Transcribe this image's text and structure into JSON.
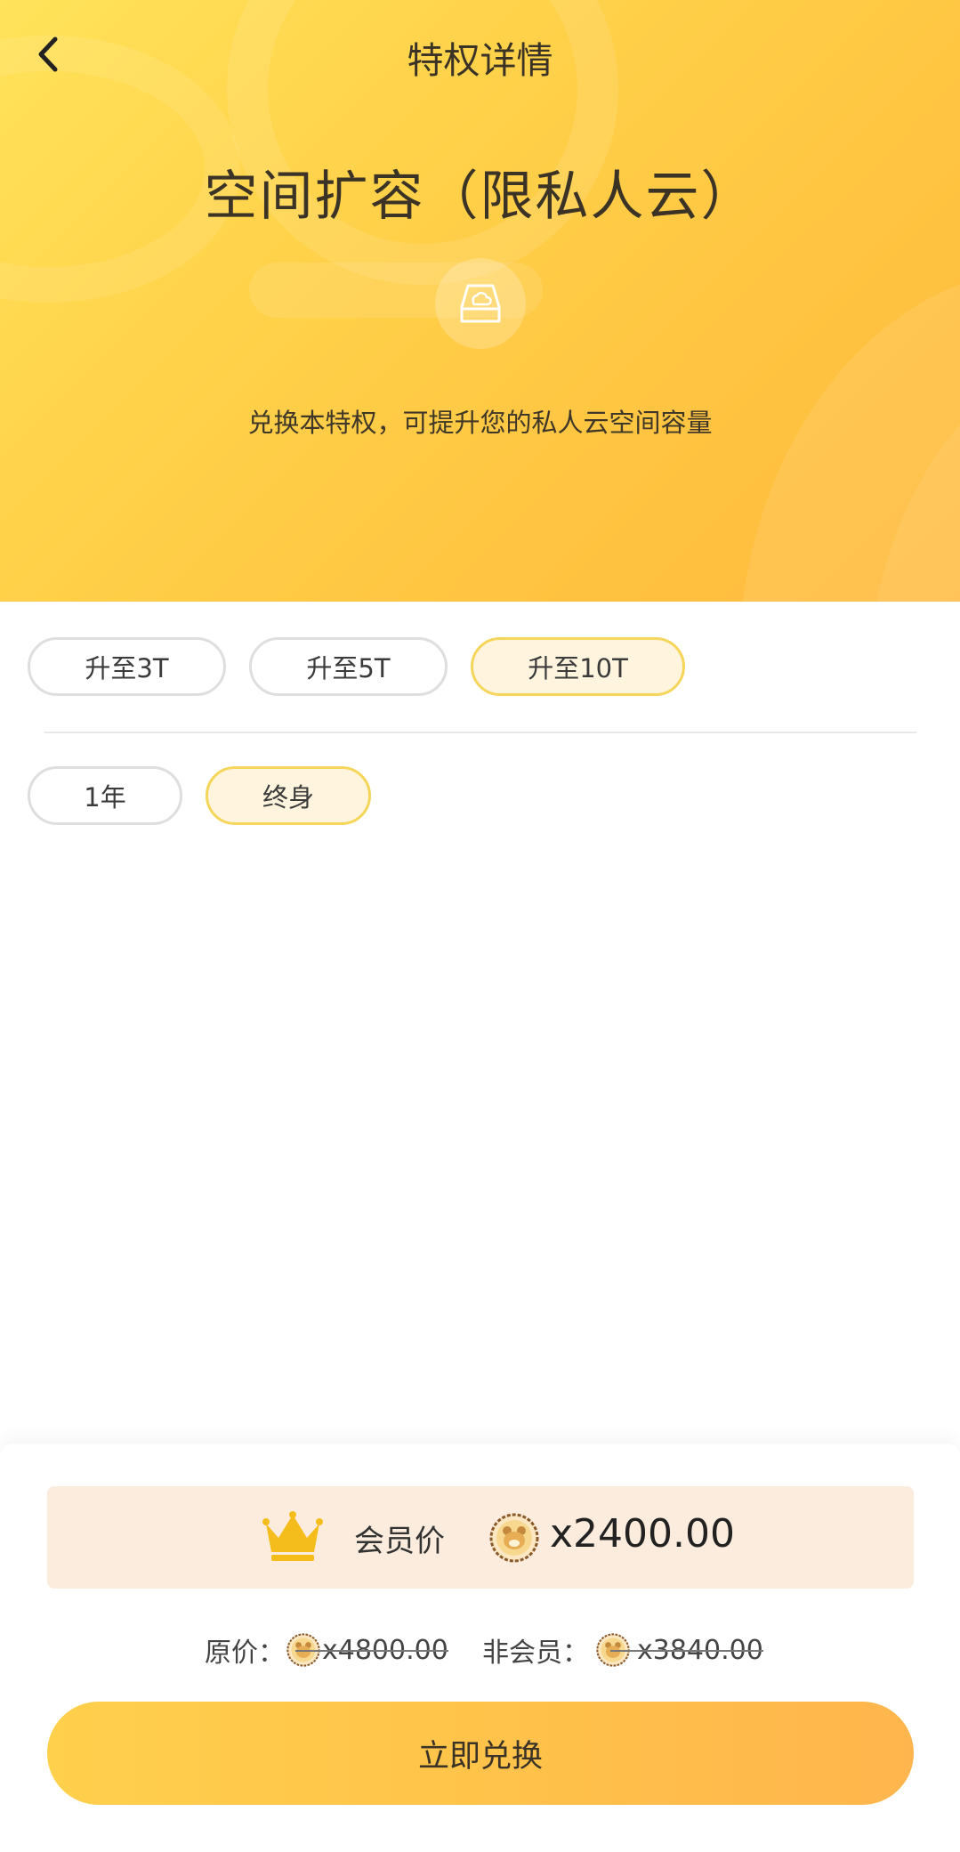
{
  "header": {
    "title": "特权详情"
  },
  "hero": {
    "title": "空间扩容（限私人云）",
    "description": "兑换本特权，可提升您的私人云空间容量"
  },
  "capacity_options": [
    {
      "label": "升至3T",
      "selected": false
    },
    {
      "label": "升至5T",
      "selected": false
    },
    {
      "label": "升至10T",
      "selected": true
    }
  ],
  "duration_options": [
    {
      "label": "1年",
      "selected": false
    },
    {
      "label": "终身",
      "selected": true
    }
  ],
  "pricing": {
    "member_label": "会员价",
    "member_price": "x2400.00",
    "original_label": "原价：",
    "original_price": "x4800.00",
    "nonmember_label": "非会员：",
    "nonmember_price": "x3840.00"
  },
  "action": {
    "redeem_label": "立即兑换"
  },
  "colors": {
    "accent": "#ffc441",
    "selected_border": "#f6d55b",
    "selected_bg": "#fff4dd"
  }
}
